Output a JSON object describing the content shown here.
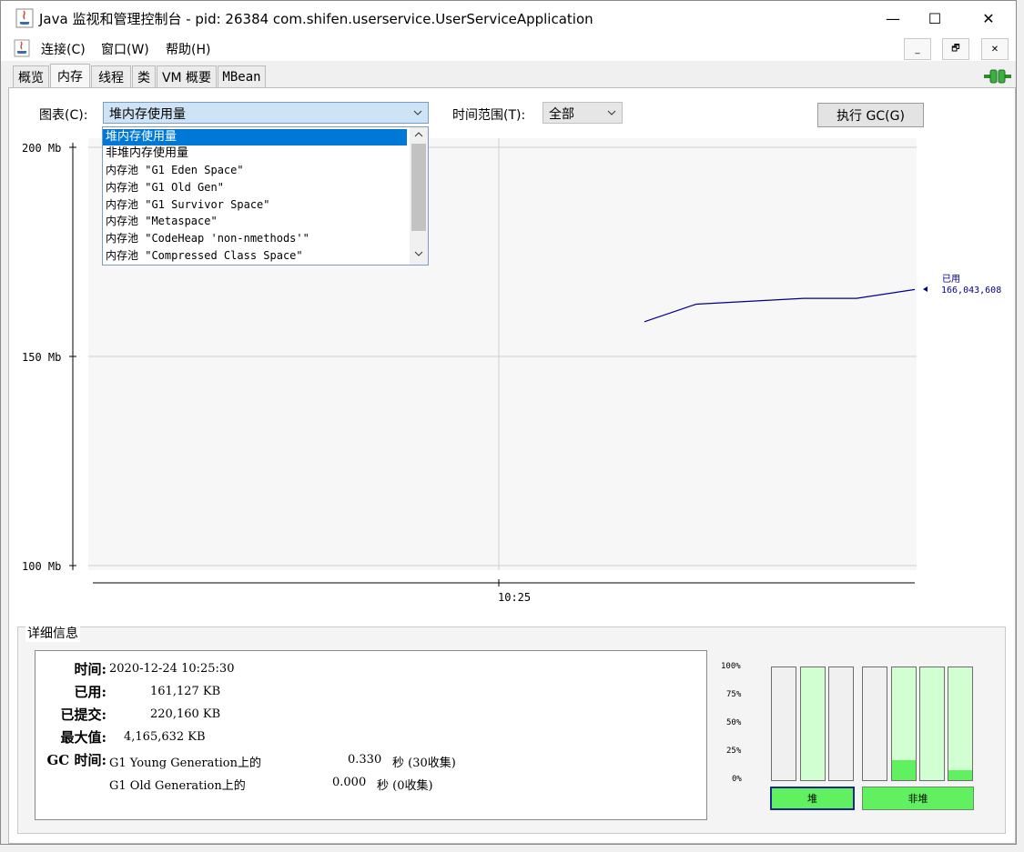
{
  "window": {
    "title": "Java 监视和管理控制台 - pid: 26384 com.shifen.userservice.UserServiceApplication",
    "controls": {
      "minimize": "—",
      "maximize": "☐",
      "close": "✕"
    },
    "mdi_controls": {
      "minimize": "_",
      "restore": "🗗",
      "close": "✕"
    }
  },
  "menu": [
    "连接(C)",
    "窗口(W)",
    "帮助(H)"
  ],
  "tabs": [
    {
      "label": "概览",
      "active": false
    },
    {
      "label": "内存",
      "active": true
    },
    {
      "label": "线程",
      "active": false
    },
    {
      "label": "类",
      "active": false
    },
    {
      "label": "VM 概要",
      "active": false
    },
    {
      "label": "MBean",
      "active": false
    }
  ],
  "toolbar": {
    "chart_label": "图表(C):",
    "chart_selected": "堆内存使用量",
    "range_label": "时间范围(T):",
    "range_selected": "全部",
    "gc_button": "执行 GC(G)"
  },
  "dropdown_options": [
    "堆内存使用量",
    "非堆内存使用量",
    "内存池 \"G1 Eden Space\"",
    "内存池 \"G1 Old Gen\"",
    "内存池 \"G1 Survivor Space\"",
    "内存池 \"Metaspace\"",
    "内存池 \"CodeHeap 'non-nmethods'\"",
    "内存池 \"Compressed Class Space\""
  ],
  "chart_data": {
    "type": "line",
    "y_ticks": [
      "200 Mb",
      "150 Mb",
      "100 Mb"
    ],
    "ylim": [
      100,
      200
    ],
    "x_ticks": [
      "10:25"
    ],
    "series": [
      {
        "name": "已用",
        "color": "#00008b",
        "x": [
          0,
          1,
          2,
          3,
          4
        ],
        "values": [
          158.3,
          162.5,
          163.9,
          163.9,
          166.0
        ]
      }
    ],
    "latest_label": "已用",
    "latest_value": "166,043,608"
  },
  "details": {
    "title": "详细信息",
    "time_label": "时间:",
    "time_value": "2020-12-24 10:25:30",
    "used_label": "已用:",
    "used_value": "161,127 KB",
    "committed_label": "已提交:",
    "committed_value": "220,160 KB",
    "max_label": "最大值:",
    "max_value": "4,165,632 KB",
    "gc_label": "GC 时间:",
    "gc_rows": [
      {
        "name": "G1 Young Generation上的",
        "value": "0.330",
        "unit": "秒 (30收集)"
      },
      {
        "name": "G1 Old Generation上的",
        "value": "0.000",
        "unit": "秒 (0收集)"
      }
    ]
  },
  "pool_bars": {
    "pct_labels": [
      "100%",
      "75%",
      "50%",
      "25%",
      "0%"
    ],
    "heap": [
      {
        "committed": 0.0,
        "used": 0.0
      },
      {
        "committed": 1.0,
        "used": 0.0
      },
      {
        "committed": 0.0,
        "used": 0.0
      }
    ],
    "nonheap": [
      {
        "committed": 0.0,
        "used": 0.0
      },
      {
        "committed": 1.0,
        "used": 0.18
      },
      {
        "committed": 1.0,
        "used": 0.0
      },
      {
        "committed": 1.0,
        "used": 0.09
      }
    ],
    "heap_label": "堆",
    "nonheap_label": "非堆"
  },
  "colors": {
    "accent": "#0078d7",
    "line": "#00008b",
    "pool_used": "#60f060",
    "pool_committed": "#d2ffd2"
  }
}
